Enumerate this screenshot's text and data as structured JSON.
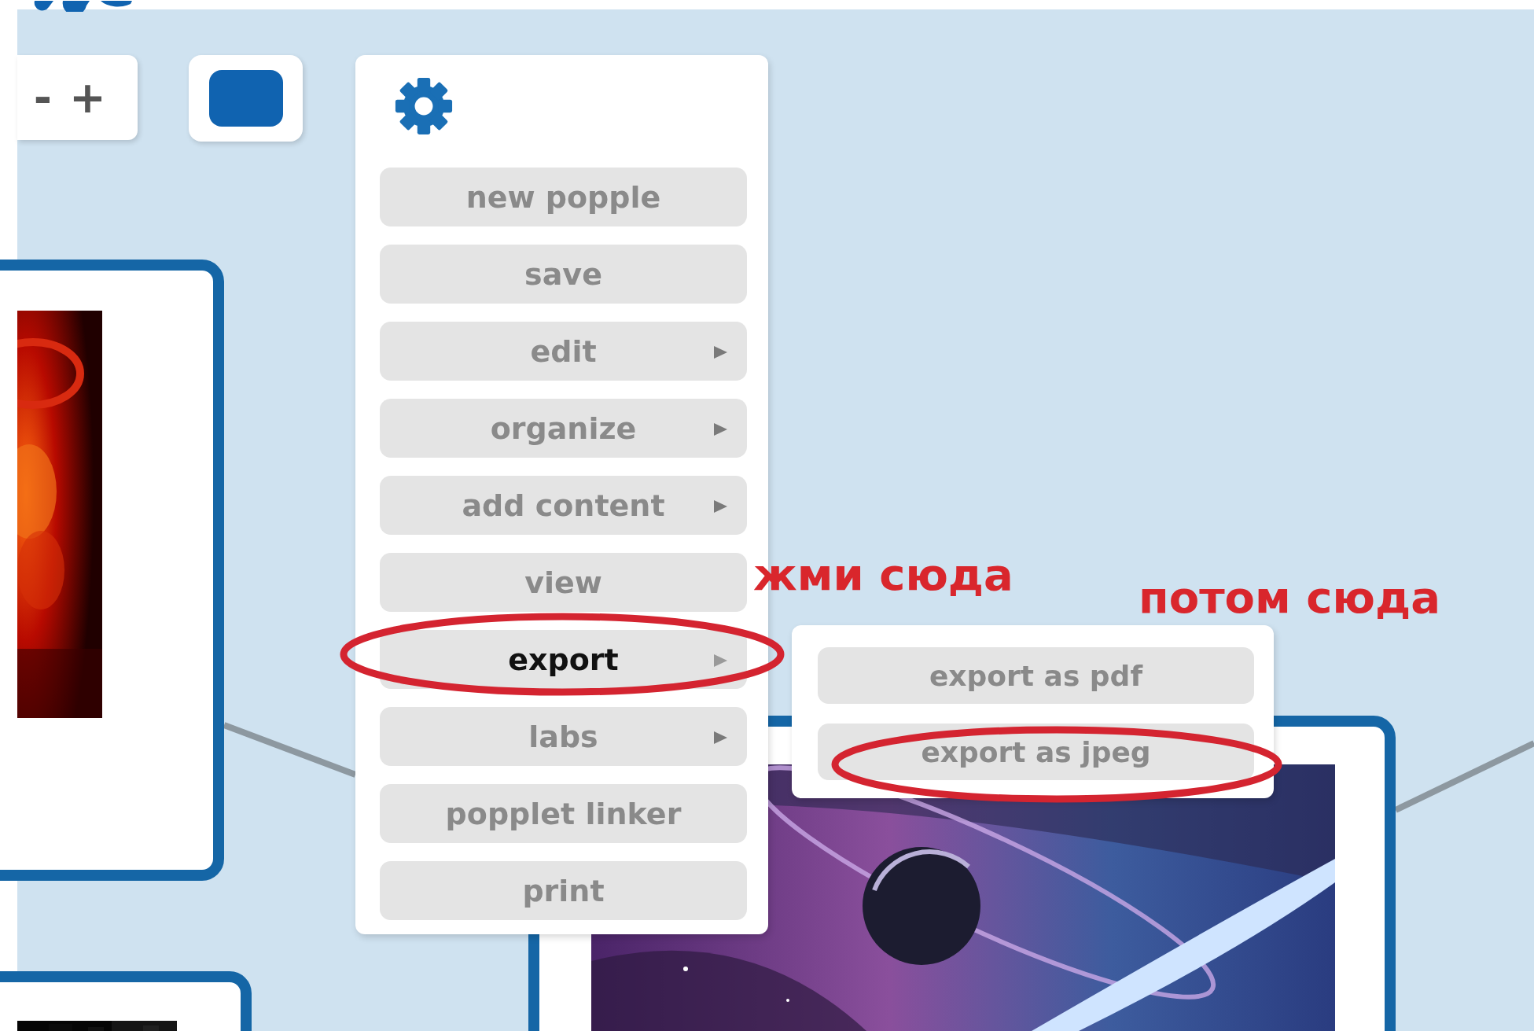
{
  "zoom_controls": {
    "zoom_out": "-",
    "zoom_in": "+"
  },
  "menu": {
    "items": [
      {
        "label": "new popple",
        "selected": false,
        "submenu": false
      },
      {
        "label": "save",
        "selected": false,
        "submenu": false
      },
      {
        "label": "edit",
        "selected": false,
        "submenu": true
      },
      {
        "label": "organize",
        "selected": false,
        "submenu": true
      },
      {
        "label": "add content",
        "selected": false,
        "submenu": true
      },
      {
        "label": "view",
        "selected": false,
        "submenu": false
      },
      {
        "label": "export",
        "selected": true,
        "submenu": true
      },
      {
        "label": "labs",
        "selected": false,
        "submenu": true
      },
      {
        "label": "popplet linker",
        "selected": false,
        "submenu": false
      },
      {
        "label": "print",
        "selected": false,
        "submenu": false
      }
    ]
  },
  "submenu": {
    "items": [
      {
        "label": "export as pdf",
        "selected": false
      },
      {
        "label": "export as jpeg",
        "selected": false
      }
    ]
  },
  "annotations": [
    {
      "text": "жми сюда"
    },
    {
      "text": "потом сюда"
    }
  ]
}
